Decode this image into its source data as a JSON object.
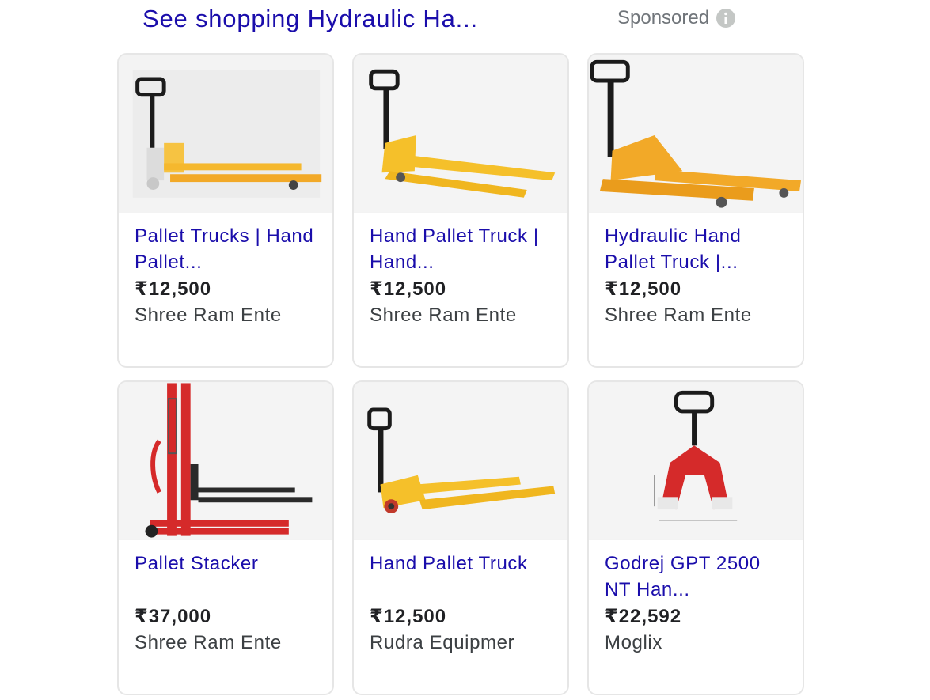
{
  "header": {
    "title": "See shopping Hydraulic Ha...",
    "sponsored_label": "Sponsored",
    "info_icon": "info-icon"
  },
  "products": [
    {
      "title": "Pallet Trucks | Hand Pallet...",
      "price": "₹12,500",
      "seller": "Shree Ram Ente",
      "image_icon": "yellow-hand-pallet-truck-image"
    },
    {
      "title": "Hand Pallet Truck | Hand...",
      "price": "₹12,500",
      "seller": "Shree Ram Ente",
      "image_icon": "yellow-hand-pallet-truck-image"
    },
    {
      "title": "Hydraulic Hand Pallet Truck |...",
      "price": "₹12,500",
      "seller": "Shree Ram Ente",
      "image_icon": "orange-hand-pallet-truck-image"
    },
    {
      "title": "Pallet Stacker",
      "price": "₹37,000",
      "seller": "Shree Ram Ente",
      "image_icon": "red-pallet-stacker-image"
    },
    {
      "title": "Hand Pallet Truck",
      "price": "₹12,500",
      "seller": "Rudra Equipmer",
      "image_icon": "yellow-hand-pallet-truck-image"
    },
    {
      "title": "Godrej GPT 2500 NT Han...",
      "price": "₹22,592",
      "seller": "Moglix",
      "image_icon": "red-hand-pallet-truck-image"
    }
  ],
  "colors": {
    "link": "#1a0dab",
    "price": "#202124",
    "seller": "#3c4043",
    "muted": "#70757a",
    "yellow": "#f5c02a",
    "orange": "#f2a928",
    "red": "#d52a2a"
  }
}
